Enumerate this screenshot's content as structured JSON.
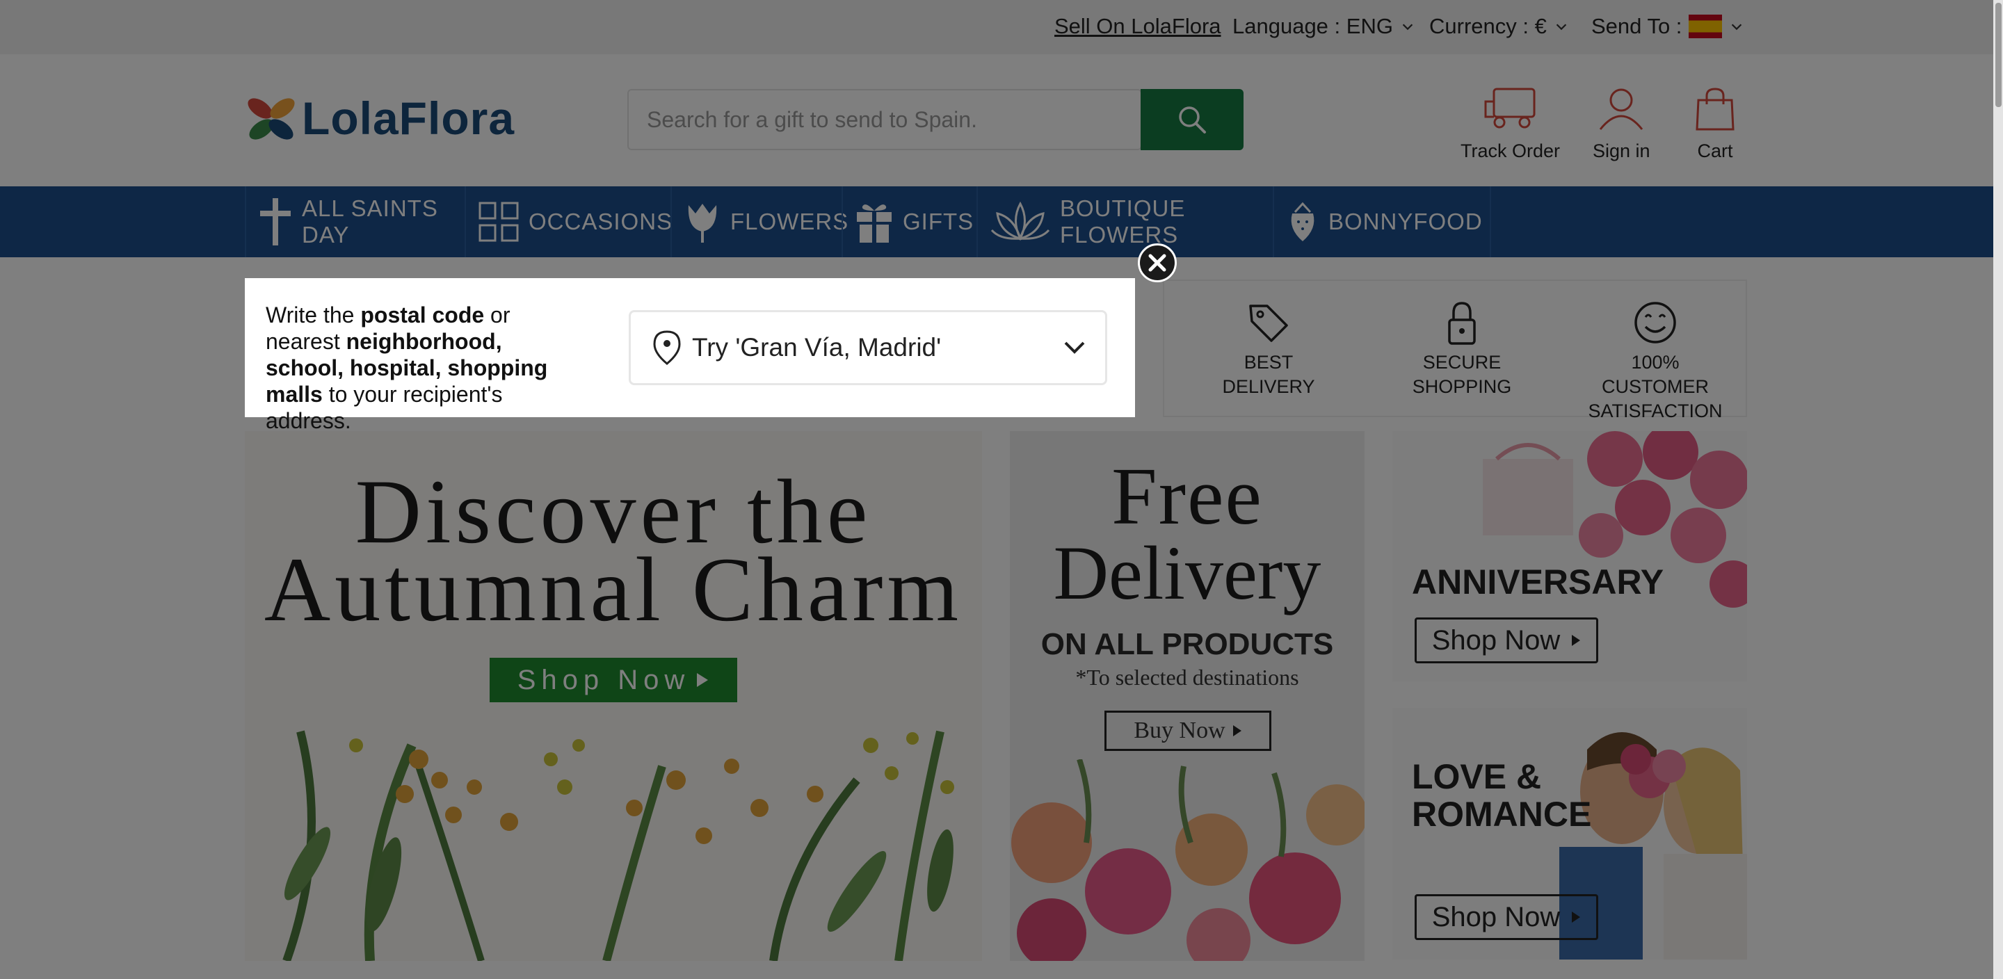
{
  "topbar": {
    "sell_label": "Sell On LolaFlora",
    "language_label": "Language : ENG",
    "currency_label": "Currency : €",
    "send_to_label": "Send To :"
  },
  "header": {
    "logo_text": "LolaFlora",
    "search_placeholder": "Search for a gift to send to Spain.",
    "track_label": "Track Order",
    "signin_label": "Sign in",
    "cart_label": "Cart"
  },
  "nav": {
    "items": [
      {
        "label": "ALL SAINTS DAY",
        "icon": "cross-icon"
      },
      {
        "label": "OCCASIONS",
        "icon": "grid-icon"
      },
      {
        "label": "FLOWERS",
        "icon": "tulip-icon"
      },
      {
        "label": "GIFTS",
        "icon": "gift-icon"
      },
      {
        "label": "BOUTIQUE FLOWERS",
        "icon": "lotus-icon"
      },
      {
        "label": "BONNYFOOD",
        "icon": "strawberry-icon"
      }
    ]
  },
  "trust": {
    "items": [
      {
        "line1": "BEST",
        "line2": "DELIVERY",
        "icon": "tag-icon"
      },
      {
        "line1": "SECURE",
        "line2": "SHOPPING",
        "icon": "lock-icon"
      },
      {
        "line1": "100% CUSTOMER",
        "line2": "SATISFACTION",
        "icon": "smile-icon"
      }
    ]
  },
  "banners": {
    "main_line1": "Discover the",
    "main_line2": "Autumnal Charm",
    "main_button": "Shop Now",
    "free_line1": "Free",
    "free_line2": "Delivery",
    "free_line3": "ON ALL PRODUCTS",
    "free_line4": "*To selected destinations",
    "free_button": "Buy Now",
    "anniversary_title": "ANNIVERSARY",
    "anniversary_button": "Shop Now",
    "romance_line1": "LOVE &",
    "romance_line2": "ROMANCE",
    "romance_button": "Shop Now"
  },
  "popup": {
    "text_1": "Write the ",
    "text_bold_1": "postal code",
    "text_2": " or nearest ",
    "text_bold_2": "neighborhood, school, hospital, shopping malls",
    "text_3": " to your recipient's address.",
    "select_value": "Try 'Gran Vía, Madrid'"
  },
  "colors": {
    "nav_bg": "#1d4f8c",
    "search_button": "#167a43",
    "logo_blue": "#1b4a78",
    "icon_red": "#d2483c"
  }
}
